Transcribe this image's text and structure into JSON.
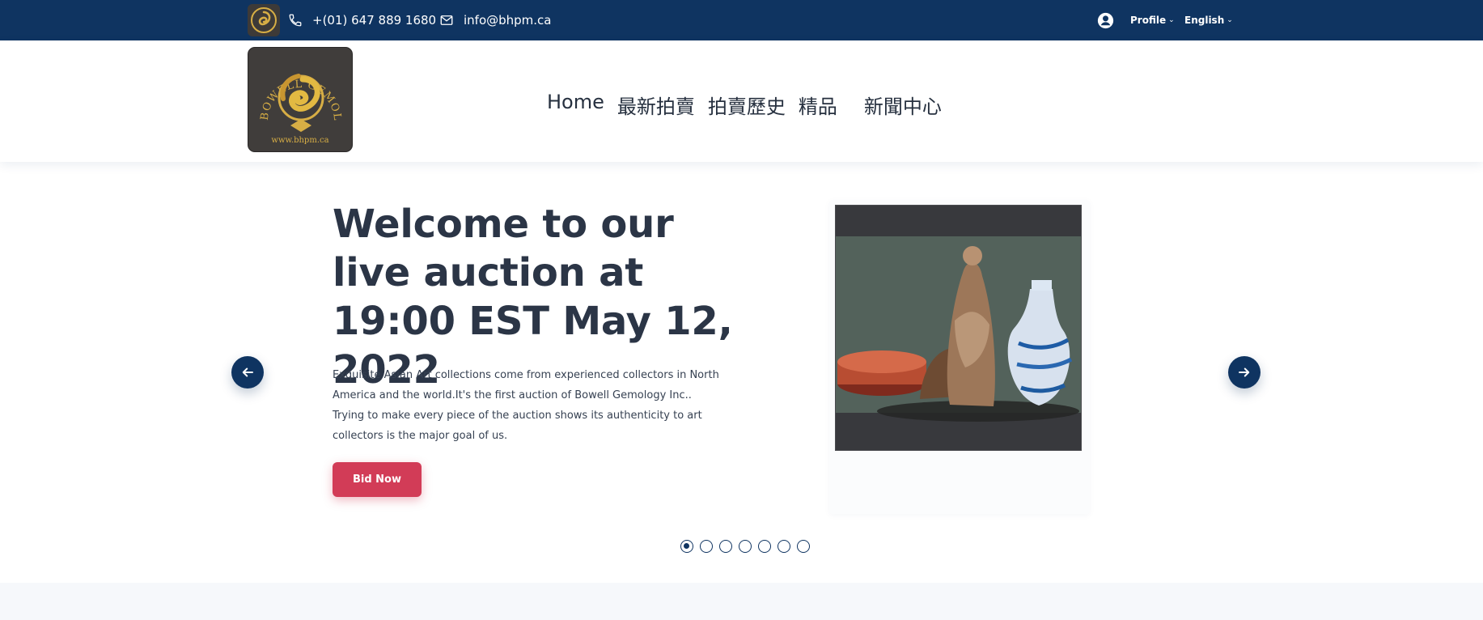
{
  "topbar": {
    "phone": "+(01) 647 889 1680",
    "email": "info@bhpm.ca",
    "profile_label": "Profile",
    "language_label": "English",
    "icons": [
      "logo-icon",
      "phone-icon",
      "mail-icon",
      "user-circle-icon",
      "chevron-down-icon"
    ]
  },
  "header": {
    "logo_text": "BOWELL GEMOLOGY INC",
    "logo_url": "www.bhpm.ca",
    "nav": [
      {
        "label": "Home"
      },
      {
        "label": "最新拍賣"
      },
      {
        "label": "拍賣歷史"
      },
      {
        "label": "精品"
      },
      {
        "label": "新聞中心"
      }
    ]
  },
  "hero": {
    "title": "Welcome to our live auction at 19:00 EST May 12, 2022",
    "description": "Exquisite Asian Art collections come from experienced collectors in North America and the world.It's the first auction of Bowell Gemology Inc.. Trying to make every piece of the auction shows its authenticity to art collectors is the major goal of us.",
    "button_label": "Bid Now"
  },
  "carousel": {
    "slide_count": 7,
    "active_slide": 1
  },
  "colors": {
    "navy": "#0f3461",
    "accent_red": "#d23c57",
    "gold": "#d7ae45",
    "text": "#26303f"
  }
}
